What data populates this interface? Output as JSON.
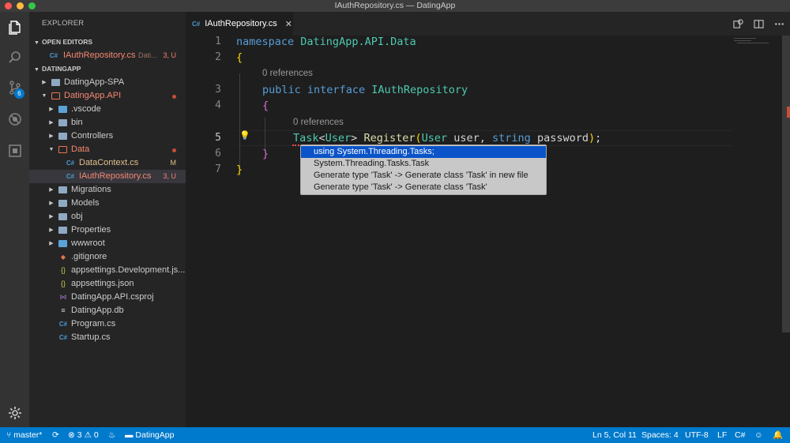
{
  "window": {
    "title": "IAuthRepository.cs — DatingApp"
  },
  "activity_bar": {
    "items": [
      {
        "name": "files-icon"
      },
      {
        "name": "search-icon"
      },
      {
        "name": "source-control-icon",
        "badge": "6"
      },
      {
        "name": "debug-icon"
      },
      {
        "name": "extensions-icon"
      }
    ],
    "settings_icon": "gear-icon"
  },
  "sidebar": {
    "title": "EXPLORER",
    "open_editors": {
      "label": "OPEN EDITORS",
      "items": [
        {
          "name": "IAuthRepository.cs",
          "path": "Dati...",
          "status": "3, U"
        }
      ]
    },
    "workspace": {
      "label": "DATINGAPP",
      "items": [
        {
          "label": "DatingApp-SPA"
        },
        {
          "label": "DatingApp.API"
        },
        {
          "label": ".vscode"
        },
        {
          "label": "bin"
        },
        {
          "label": "Controllers"
        },
        {
          "label": "Data"
        },
        {
          "label": "DataContext.cs",
          "status": "M"
        },
        {
          "label": "IAuthRepository.cs",
          "status": "3, U"
        },
        {
          "label": "Migrations"
        },
        {
          "label": "Models"
        },
        {
          "label": "obj"
        },
        {
          "label": "Properties"
        },
        {
          "label": "wwwroot"
        },
        {
          "label": ".gitignore"
        },
        {
          "label": "appsettings.Development.js..."
        },
        {
          "label": "appsettings.json"
        },
        {
          "label": "DatingApp.API.csproj"
        },
        {
          "label": "DatingApp.db"
        },
        {
          "label": "Program.cs"
        },
        {
          "label": "Startup.cs"
        }
      ]
    }
  },
  "tabs": [
    {
      "label": "IAuthRepository.cs",
      "icon": "C#",
      "close": "✕"
    }
  ],
  "editor": {
    "line_numbers": [
      "1",
      "2",
      "3",
      "4",
      "5",
      "6",
      "7"
    ],
    "codelens": [
      "0 references",
      "0 references"
    ],
    "lines": {
      "l1_kw": "namespace",
      "l1_ns": "DatingApp.API.Data",
      "l2": "{",
      "l3_kw1": "public",
      "l3_kw2": "interface",
      "l3_name": "IAuthRepository",
      "l4": "{",
      "l5_task": "Task",
      "l5_lt": "<",
      "l5_user": "User",
      "l5_gt": ">",
      "l5_fn": "Register",
      "l5_paren_open": "(",
      "l5_type1": "User",
      "l5_p1": " user, ",
      "l5_type2": "string",
      "l5_p2": " password",
      "l5_paren_close": ")",
      "l5_semi": ";",
      "l6": "}",
      "l7": "}"
    }
  },
  "quick_fix": {
    "items": [
      "using System.Threading.Tasks;",
      "System.Threading.Tasks.Task",
      "Generate type 'Task' -> Generate class 'Task' in new file",
      "Generate type 'Task' -> Generate class 'Task'"
    ],
    "selected_index": 0
  },
  "statusbar": {
    "branch": "master*",
    "errors": "3",
    "warnings": "0",
    "project": "DatingApp",
    "position": "Ln 5, Col 11",
    "spaces": "Spaces: 4",
    "encoding": "UTF-8",
    "eol": "LF",
    "language": "C#"
  }
}
